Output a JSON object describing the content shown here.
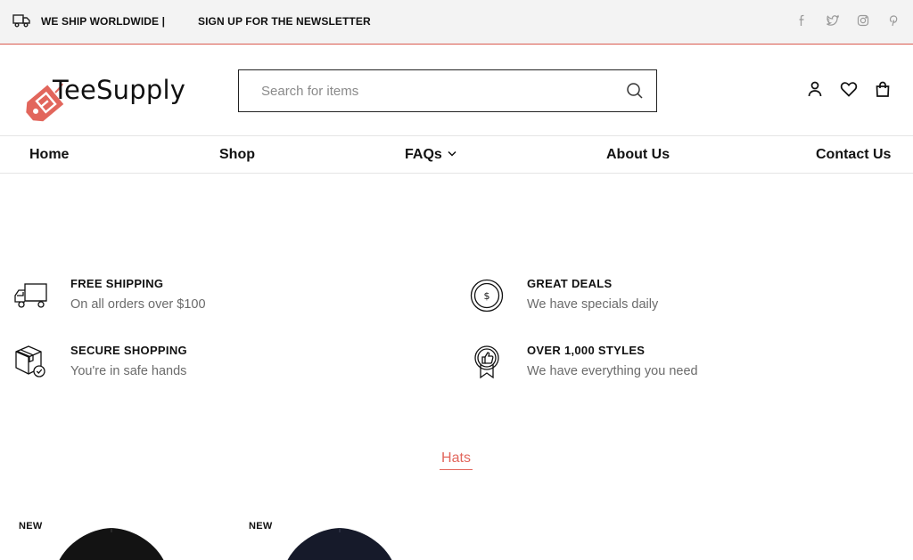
{
  "topbar": {
    "ship_text": "WE SHIP WORLDWIDE |",
    "newsletter_text": "SIGN UP FOR THE NEWSLETTER",
    "truck_icon": "truck-icon",
    "social_icons": [
      "facebook-icon",
      "twitter-icon",
      "instagram-icon",
      "pinterest-icon"
    ]
  },
  "header": {
    "logo_text": "TeeSupply",
    "search": {
      "placeholder": "Search for items",
      "value": ""
    },
    "icons": [
      "user-icon",
      "heart-icon",
      "bag-icon"
    ]
  },
  "nav": {
    "items": [
      {
        "label": "Home"
      },
      {
        "label": "Shop"
      },
      {
        "label": "FAQs",
        "has_dropdown": true
      },
      {
        "label": "About Us"
      },
      {
        "label": "Contact Us"
      }
    ]
  },
  "features": [
    {
      "title": "FREE SHIPPING",
      "subtitle": "On all orders over $100",
      "icon": "delivery-truck-icon"
    },
    {
      "title": "GREAT DEALS",
      "subtitle": "We have specials daily",
      "icon": "dollar-coin-icon"
    },
    {
      "title": "SECURE SHOPPING",
      "subtitle": "You're in safe hands",
      "icon": "secure-box-icon"
    },
    {
      "title": "OVER 1,000 STYLES",
      "subtitle": "We have everything you need",
      "icon": "thumbs-up-award-icon"
    }
  ],
  "section": {
    "title": "Hats"
  },
  "products": [
    {
      "badge": "NEW"
    },
    {
      "badge": "NEW"
    }
  ],
  "colors": {
    "accent": "#e2665c",
    "topbar_bg": "#f3f3f3",
    "text": "#111111",
    "muted": "#6b6b6b"
  }
}
